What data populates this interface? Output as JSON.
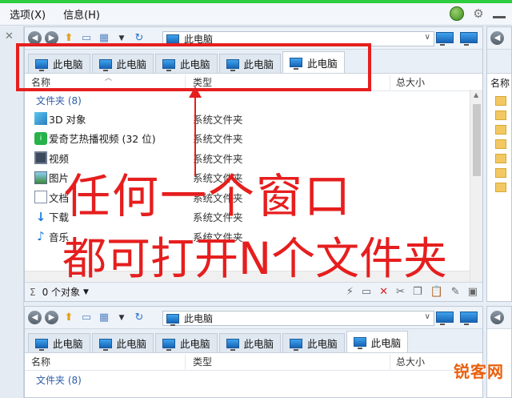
{
  "menubar": {
    "items": [
      "选项(X)",
      "信息(H)"
    ]
  },
  "top_pane": {
    "address": "此电脑",
    "tabs": [
      "此电脑",
      "此电脑",
      "此电脑",
      "此电脑",
      "此电脑"
    ],
    "columns": {
      "name": "名称",
      "type": "类型",
      "size": "总大小"
    },
    "group": "文件夹 (8)",
    "rows": [
      {
        "name": "3D 对象",
        "type": "系统文件夹",
        "icon": "3d-objects-icon"
      },
      {
        "name": "爱奇艺热播视频 (32 位)",
        "type": "系统文件夹",
        "icon": "iqiyi-icon"
      },
      {
        "name": "视频",
        "type": "系统文件夹",
        "icon": "video-icon"
      },
      {
        "name": "图片",
        "type": "系统文件夹",
        "icon": "pictures-icon"
      },
      {
        "name": "文档",
        "type": "系统文件夹",
        "icon": "documents-icon"
      },
      {
        "name": "下载",
        "type": "系统文件夹",
        "icon": "download-icon"
      },
      {
        "name": "音乐",
        "type": "系统文件夹",
        "icon": "music-icon"
      }
    ],
    "status": "0 个对象"
  },
  "bottom_pane": {
    "address": "此电脑",
    "tabs": [
      "此电脑",
      "此电脑",
      "此电脑",
      "此电脑",
      "此电脑",
      "此电脑"
    ],
    "columns": {
      "name": "名称",
      "type": "类型",
      "size": "总大小"
    },
    "group": "文件夹 (8)"
  },
  "right_pane": {
    "column": "名称"
  },
  "overlay": {
    "line1": "任何一个窗口",
    "line2": "都可打开N个文件夹",
    "watermark": "锐客网",
    "color": "#e61e1e"
  }
}
